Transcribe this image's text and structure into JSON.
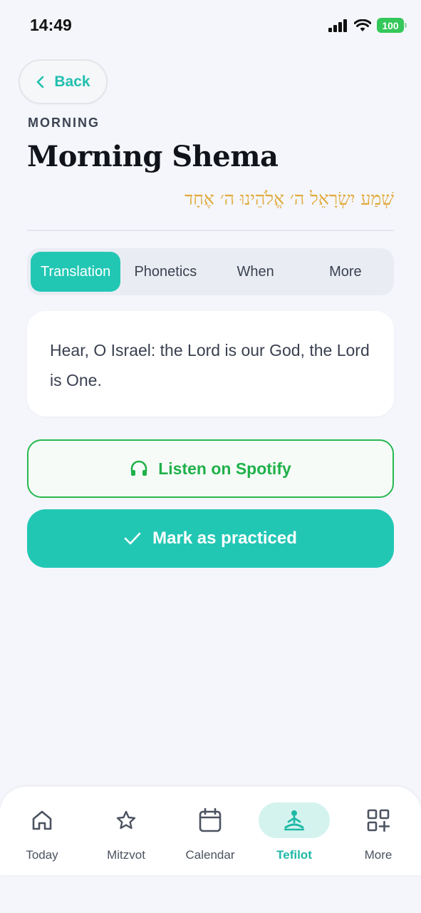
{
  "status": {
    "time": "14:49",
    "battery": "100"
  },
  "header": {
    "back_label": "Back",
    "overline": "MORNING",
    "title": "Morning Shema",
    "hebrew": "שְׁמַע יִשְׂרָאֵל ה׳ אֱלֹהֵינוּ ה׳ אֶחָד"
  },
  "tabs": [
    {
      "label": "Translation",
      "active": true
    },
    {
      "label": "Phonetics",
      "active": false
    },
    {
      "label": "When",
      "active": false
    },
    {
      "label": "More",
      "active": false
    }
  ],
  "card": {
    "text": "Hear, O Israel: the Lord is our God, the Lord is One."
  },
  "actions": {
    "spotify_label": "Listen on Spotify",
    "practice_label": "Mark as practiced"
  },
  "nav": [
    {
      "label": "Today",
      "icon": "home-icon"
    },
    {
      "label": "Mitzvot",
      "icon": "star-icon"
    },
    {
      "label": "Calendar",
      "icon": "calendar-icon"
    },
    {
      "label": "Tefilot",
      "icon": "prayer-icon",
      "active": true
    },
    {
      "label": "More",
      "icon": "grid-plus-icon"
    }
  ],
  "colors": {
    "accent": "#22c7b4",
    "spotify": "#27b84f",
    "hebrew": "#e2a93b"
  }
}
